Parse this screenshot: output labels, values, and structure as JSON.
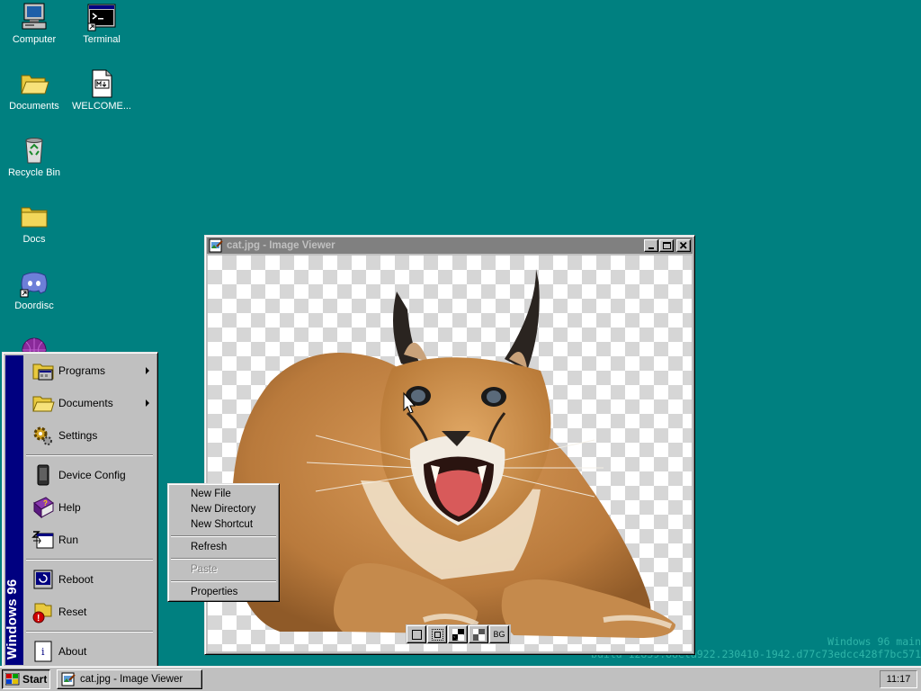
{
  "desktop": {
    "icons": [
      {
        "label": "Computer",
        "icon": "computer-icon"
      },
      {
        "label": "Terminal",
        "icon": "terminal-icon"
      },
      {
        "label": "Documents",
        "icon": "folder-open-icon"
      },
      {
        "label": "WELCOME...",
        "icon": "markdown-file-icon"
      },
      {
        "label": "Recycle Bin",
        "icon": "recycle-bin-icon"
      },
      {
        "label": "Docs",
        "icon": "folder-icon"
      },
      {
        "label": "Doordisc",
        "icon": "discord-icon"
      }
    ],
    "watermark": {
      "line1": "Windows 96 main",
      "line2": "build 12839.88eta922.230410-1942.d77c73edcc428f7bc571"
    }
  },
  "window": {
    "title": "cat.jpg - Image Viewer",
    "toolbar": [
      {
        "icon": "fit-window-icon"
      },
      {
        "icon": "actual-size-icon"
      },
      {
        "icon": "checker-light-icon"
      },
      {
        "icon": "checker-dark-icon"
      },
      {
        "label": "BG",
        "icon": "background-icon"
      }
    ]
  },
  "start_menu": {
    "banner": "Windows 96",
    "items": [
      {
        "label": "Programs",
        "icon": "programs-icon",
        "submenu": true
      },
      {
        "label": "Documents",
        "icon": "documents-icon",
        "submenu": true
      },
      {
        "label": "Settings",
        "icon": "settings-icon",
        "submenu": false
      },
      {
        "label": "Device Config",
        "icon": "device-icon",
        "submenu": false
      },
      {
        "label": "Help",
        "icon": "help-book-icon",
        "submenu": false
      },
      {
        "label": "Run",
        "icon": "run-icon",
        "submenu": false
      },
      {
        "label": "Reboot",
        "icon": "reboot-icon",
        "submenu": false
      },
      {
        "label": "Reset",
        "icon": "reset-icon",
        "submenu": false
      },
      {
        "label": "About",
        "icon": "about-icon",
        "submenu": false
      }
    ]
  },
  "context_menu": {
    "items": [
      {
        "label": "New File",
        "enabled": true
      },
      {
        "label": "New Directory",
        "enabled": true
      },
      {
        "label": "New Shortcut",
        "enabled": true
      },
      {
        "label": "Refresh",
        "enabled": true
      },
      {
        "label": "Paste",
        "enabled": false
      },
      {
        "label": "Properties",
        "enabled": true
      }
    ]
  },
  "taskbar": {
    "start_label": "Start",
    "tasks": [
      {
        "label": "cat.jpg - Image Viewer",
        "icon": "image-viewer-icon"
      }
    ],
    "clock": "11:17"
  },
  "colors": {
    "desktop": "#008080",
    "face": "#c0c0c0",
    "banner": "#000080",
    "inactive_title": "#808080"
  }
}
